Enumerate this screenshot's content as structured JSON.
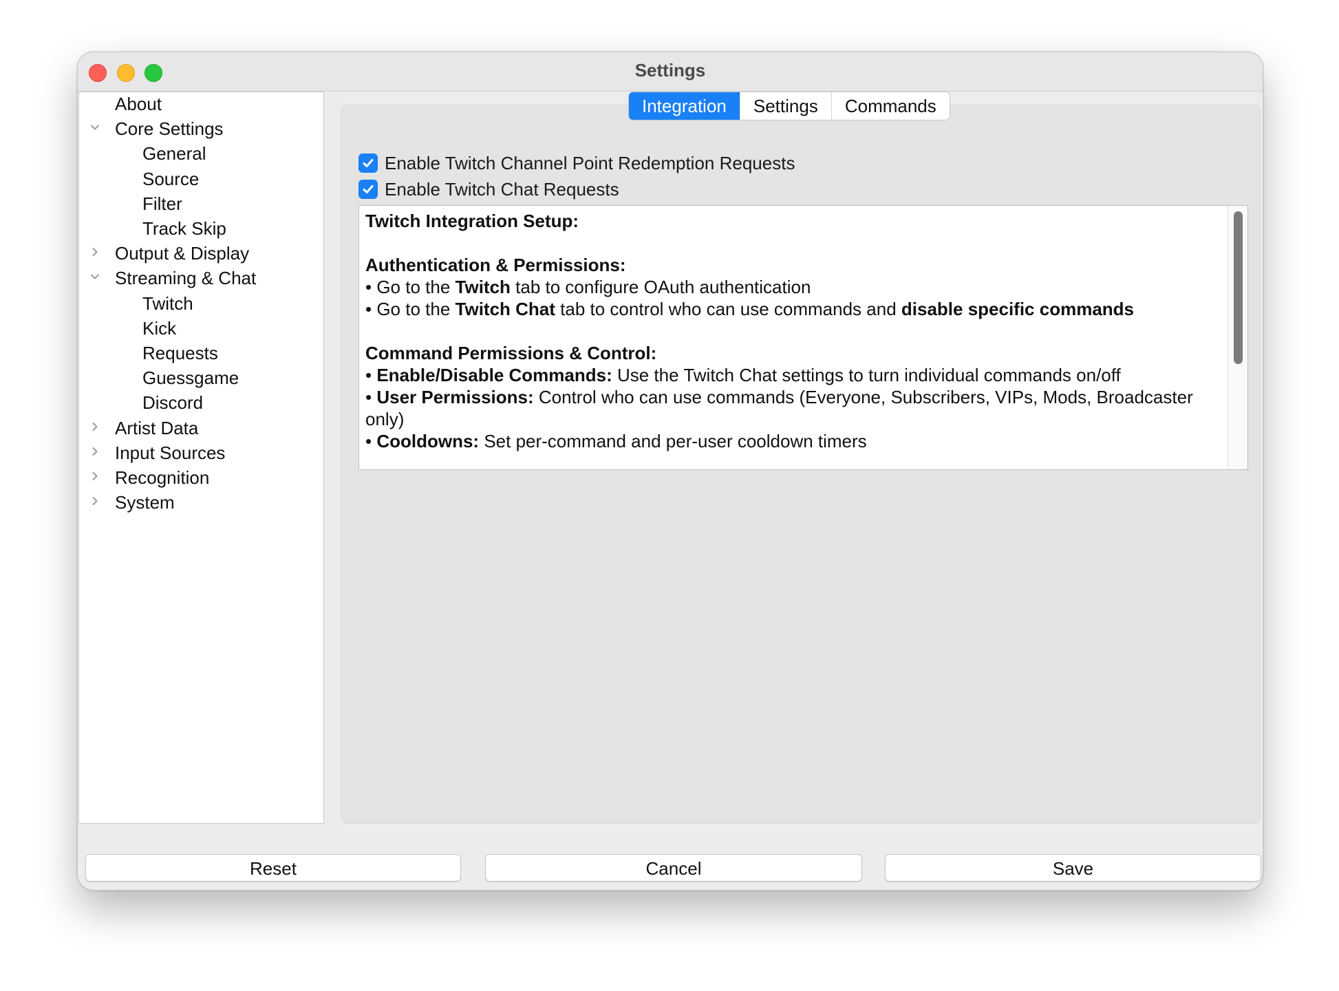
{
  "window": {
    "title": "Settings"
  },
  "sidebar": {
    "items": [
      {
        "label": "About",
        "level": 0,
        "chevron": "none"
      },
      {
        "label": "Core Settings",
        "level": 0,
        "chevron": "expanded"
      },
      {
        "label": "General",
        "level": 1,
        "chevron": "none"
      },
      {
        "label": "Source",
        "level": 1,
        "chevron": "none"
      },
      {
        "label": "Filter",
        "level": 1,
        "chevron": "none"
      },
      {
        "label": "Track Skip",
        "level": 1,
        "chevron": "none"
      },
      {
        "label": "Output & Display",
        "level": 0,
        "chevron": "collapsed"
      },
      {
        "label": "Streaming & Chat",
        "level": 0,
        "chevron": "expanded"
      },
      {
        "label": "Twitch",
        "level": 1,
        "chevron": "none"
      },
      {
        "label": "Kick",
        "level": 1,
        "chevron": "none"
      },
      {
        "label": "Requests",
        "level": 1,
        "chevron": "none"
      },
      {
        "label": "Guessgame",
        "level": 1,
        "chevron": "none"
      },
      {
        "label": "Discord",
        "level": 1,
        "chevron": "none"
      },
      {
        "label": "Artist Data",
        "level": 0,
        "chevron": "collapsed"
      },
      {
        "label": "Input Sources",
        "level": 0,
        "chevron": "collapsed"
      },
      {
        "label": "Recognition",
        "level": 0,
        "chevron": "collapsed"
      },
      {
        "label": "System",
        "level": 0,
        "chevron": "collapsed"
      }
    ]
  },
  "tabs": [
    {
      "label": "Integration",
      "active": true
    },
    {
      "label": "Settings",
      "active": false
    },
    {
      "label": "Commands",
      "active": false
    }
  ],
  "checkboxes": [
    {
      "label": "Enable Twitch Channel Point Redemption Requests",
      "checked": true
    },
    {
      "label": "Enable Twitch Chat Requests",
      "checked": true
    }
  ],
  "info": {
    "heading": "Twitch Integration Setup:",
    "auth": {
      "heading": "Authentication & Permissions:",
      "line1": {
        "pre": "• Go to the ",
        "bold": "Twitch",
        "post": " tab to configure OAuth authentication"
      },
      "line2": {
        "pre": "• Go to the ",
        "bold": "Twitch Chat",
        "mid": " tab to control who can use commands and ",
        "bold2": "disable specific commands"
      }
    },
    "commands": {
      "heading": "Command Permissions & Control:",
      "line1": {
        "pre": "• ",
        "bold": "Enable/Disable Commands:",
        "post": " Use the Twitch Chat settings to turn individual commands on/off"
      },
      "line2": {
        "pre": "• ",
        "bold": "User Permissions:",
        "post": " Control who can use commands (Everyone, Subscribers, VIPs, Mods, Broadcaster only)"
      },
      "line3": {
        "pre": "• ",
        "bold": "Cooldowns:",
        "post": " Set per-command and per-user cooldown timers"
      }
    }
  },
  "buttons": {
    "reset": "Reset",
    "cancel": "Cancel",
    "save": "Save"
  },
  "colors": {
    "accent": "#1a80f5",
    "close": "#fe5f57",
    "minimize": "#febc2e",
    "maximize": "#28c840"
  }
}
